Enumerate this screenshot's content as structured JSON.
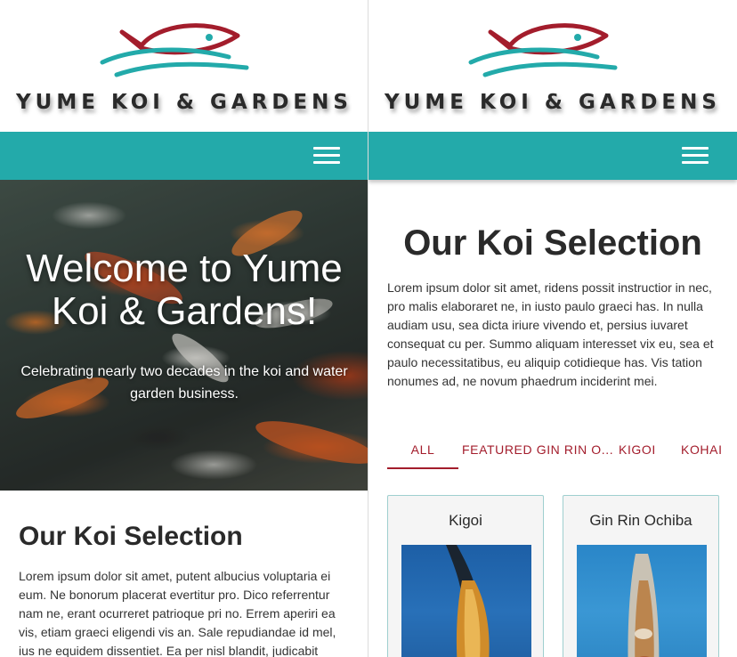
{
  "brand": {
    "name": "YUME KOI & GARDENS",
    "colors": {
      "red": "#a31d2c",
      "teal": "#23aaaa"
    }
  },
  "nav": {
    "menu_icon": "hamburger-menu-icon",
    "bar_color": "#23aaaa"
  },
  "left": {
    "hero": {
      "title": "Welcome to Yume Koi & Gardens!",
      "subtitle": "Celebrating nearly two decades in the koi and water garden business."
    },
    "section": {
      "heading": "Our Koi Selection",
      "body": "Lorem ipsum dolor sit amet, putent albucius voluptaria ei eum. Ne bonorum placerat evertitur pro. Dico referrentur nam ne, erant ocurreret patrioque pri no. Errem aperiri ea vis, etiam graeci eligendi vis an. Sale repudiandae id mel, ius ne equidem dissentiet. Ea per nisl blandit, judicabit"
    }
  },
  "right": {
    "section": {
      "heading": "Our Koi Selection",
      "body": "Lorem ipsum dolor sit amet, ridens possit instructior in nec, pro malis elaboraret ne, in iusto paulo graeci has. In nulla audiam usu, sea dicta iriure vivendo et, persius iuvaret consequat cu per. Summo aliquam interesset vix eu, sea et paulo necessitatibus, eu aliquip cotidieque has. Vis tation nonumes ad, ne novum phaedrum inciderint mei."
    },
    "tabs": [
      {
        "label": "ALL",
        "active": true
      },
      {
        "label": "FEATURED GIN RIN O...",
        "active": false
      },
      {
        "label": "KIGOI",
        "active": false
      },
      {
        "label": "KOHAI",
        "active": false
      }
    ],
    "cards": [
      {
        "title": "Kigoi"
      },
      {
        "title": "Gin Rin Ochiba"
      }
    ]
  }
}
